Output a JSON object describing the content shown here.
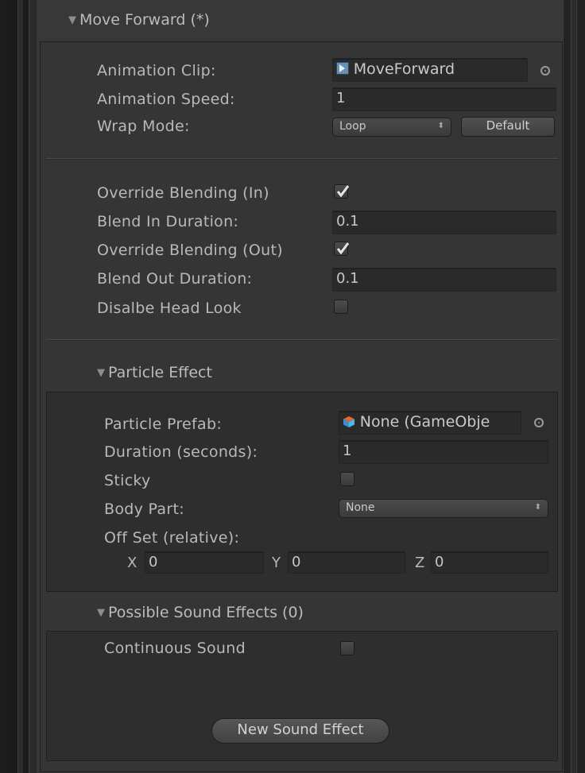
{
  "header": {
    "title": "Move Forward (*)"
  },
  "animation": {
    "clip_label": "Animation Clip:",
    "clip_value": "MoveForward",
    "speed_label": "Animation Speed:",
    "speed_value": "1",
    "wrap_label": "Wrap Mode:",
    "wrap_value": "Loop",
    "default_button": "Default"
  },
  "blending": {
    "override_in_label": "Override Blending (In)",
    "override_in_checked": true,
    "blend_in_label": "Blend In Duration:",
    "blend_in_value": "0.1",
    "override_out_label": "Override Blending (Out)",
    "override_out_checked": true,
    "blend_out_label": "Blend Out Duration:",
    "blend_out_value": "0.1",
    "disable_head_label": "Disalbe Head Look",
    "disable_head_checked": false
  },
  "particle": {
    "foldout": "Particle Effect",
    "prefab_label": "Particle Prefab:",
    "prefab_value": "None (GameObje",
    "duration_label": "Duration (seconds):",
    "duration_value": "1",
    "sticky_label": "Sticky",
    "sticky_checked": false,
    "body_part_label": "Body Part:",
    "body_part_value": "None",
    "offset_label": "Off Set (relative):",
    "x_label": "X",
    "x_value": "0",
    "y_label": "Y",
    "y_value": "0",
    "z_label": "Z",
    "z_value": "0"
  },
  "sound": {
    "foldout": "Possible Sound Effects (0)",
    "continuous_label": "Continuous Sound",
    "continuous_checked": false,
    "new_button": "New Sound Effect"
  },
  "icons": [
    "foldout-triangle-icon",
    "animation-clip-icon",
    "object-picker-icon",
    "prefab-cube-icon",
    "dropdown-arrows-icon",
    "checkmark-icon"
  ],
  "colors": {
    "background": "#383838",
    "panel": "#303030",
    "field": "#2a2a2a",
    "text": "#b9b9b9"
  }
}
